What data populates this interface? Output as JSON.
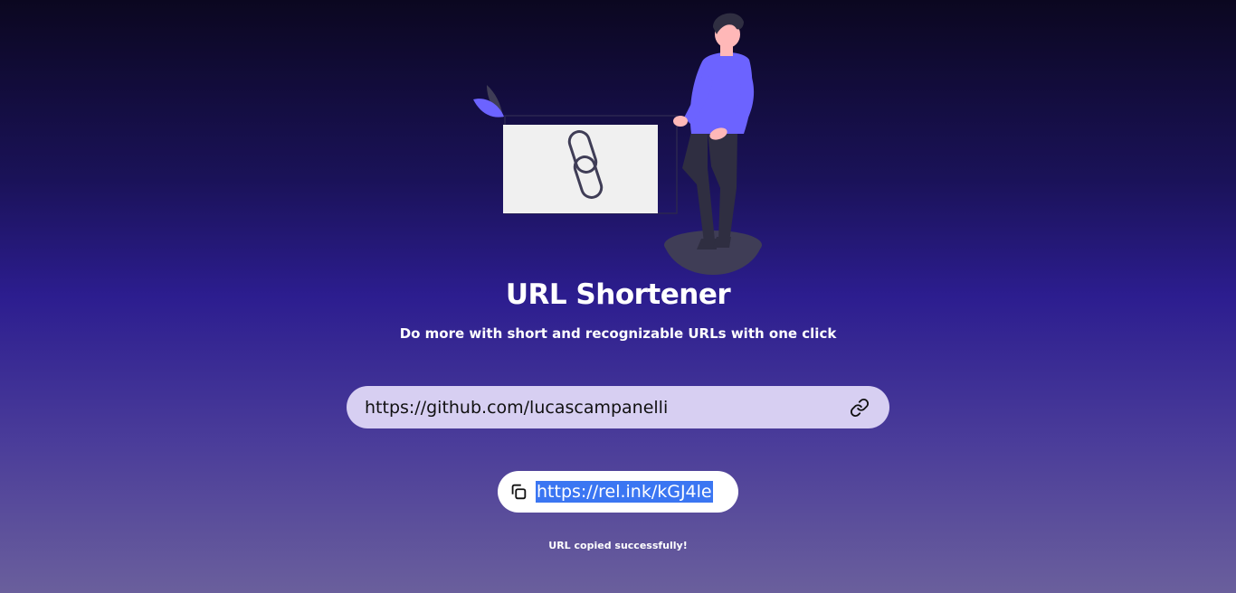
{
  "header": {
    "title": "URL Shortener",
    "subtitle": "Do more with short and recognizable URLs with one click"
  },
  "input": {
    "value": "https://github.com/lucascampanelli",
    "icon": "link-icon"
  },
  "result": {
    "short_url": "https://rel.ink/kGJ4le",
    "icon": "copy-icon",
    "selection_color": "#3b76f2"
  },
  "status": {
    "message": "URL copied successfully!"
  },
  "colors": {
    "accent": "#6c63ff",
    "input_background": "#d7cff2",
    "background_top": "#0b0720",
    "background_bottom": "#6a5f9c"
  }
}
